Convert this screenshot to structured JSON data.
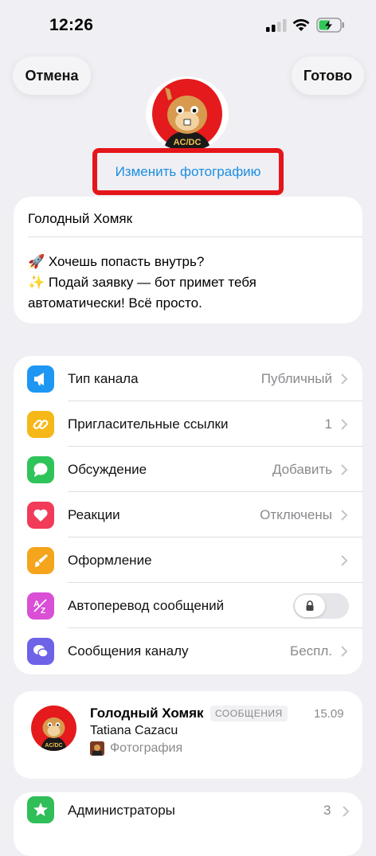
{
  "status_bar": {
    "time": "12:26"
  },
  "header": {
    "cancel_label": "Отмена",
    "done_label": "Готово"
  },
  "photo": {
    "change_label": "Изменить фотографию"
  },
  "channel": {
    "name": "Голодный Хомяк",
    "description": "🚀 Хочешь попасть внутрь?\n✨ Подай заявку — бот примет тебя автоматически! Всё просто."
  },
  "settings": {
    "items": [
      {
        "icon": "megaphone-icon",
        "label": "Тип канала",
        "value": "Публичный",
        "color": "#1e97f3"
      },
      {
        "icon": "link-icon",
        "label": "Пригласительные ссылки",
        "value": "1",
        "color": "#f5b818"
      },
      {
        "icon": "chat-bubble-icon",
        "label": "Обсуждение",
        "value": "Добавить",
        "color": "#2fc45a"
      },
      {
        "icon": "heart-icon",
        "label": "Реакции",
        "value": "Отключены",
        "color": "#f13b59"
      },
      {
        "icon": "brush-icon",
        "label": "Оформление",
        "value": "",
        "color": "#f4a51c"
      },
      {
        "icon": "translate-icon",
        "label": "Автоперевод сообщений",
        "value": "",
        "color": "#d94fd6"
      },
      {
        "icon": "chat-bubbles-icon",
        "label": "Сообщения каналу",
        "value": "Беспл.",
        "color": "#6e62e6"
      }
    ]
  },
  "message": {
    "title": "Голодный Хомяк",
    "badge": "СООБЩЕНИЯ",
    "date": "15.09",
    "author": "Tatiana Cazacu",
    "preview": "Фотография"
  },
  "admins": {
    "label": "Администраторы",
    "value": "3"
  }
}
